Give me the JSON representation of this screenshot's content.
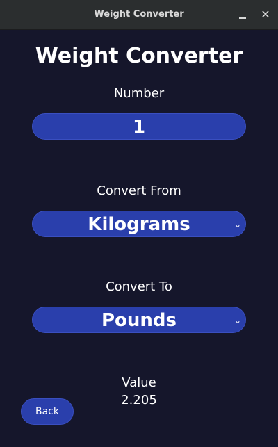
{
  "window": {
    "title": "Weight Converter",
    "minimize_icon": "minimize-icon",
    "close_icon": "close-icon"
  },
  "main": {
    "heading": "Weight Converter",
    "number": {
      "label": "Number",
      "value": "1"
    },
    "convert_from": {
      "label": "Convert From",
      "selected": "Kilograms"
    },
    "convert_to": {
      "label": "Convert To",
      "selected": "Pounds"
    },
    "result": {
      "label": "Value",
      "value": "2.205"
    },
    "back_button": "Back"
  },
  "colors": {
    "background": "#15162b",
    "accent": "#2a3fac",
    "titlebar": "#2b2e2f"
  }
}
